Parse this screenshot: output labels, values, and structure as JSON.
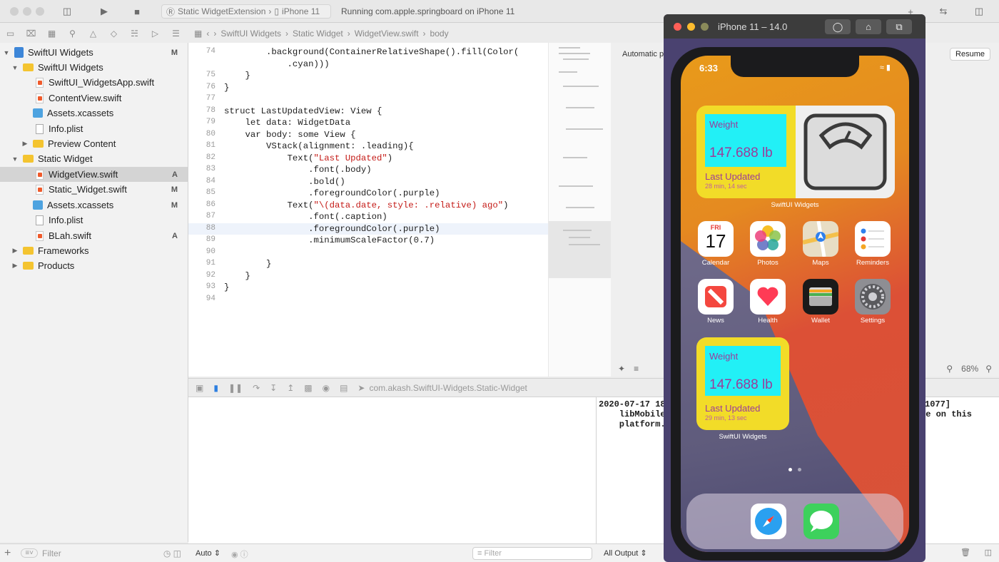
{
  "toolbar": {
    "scheme_target": "Static WidgetExtension",
    "scheme_device": "iPhone 11",
    "status_text": "Running com.apple.springboard on iPhone 11"
  },
  "navigator": {
    "items": [
      {
        "label": "SwiftUI Widgets",
        "badge": "M"
      },
      {
        "label": "SwiftUI Widgets",
        "badge": ""
      },
      {
        "label": "SwiftUI_WidgetsApp.swift",
        "badge": ""
      },
      {
        "label": "ContentView.swift",
        "badge": ""
      },
      {
        "label": "Assets.xcassets",
        "badge": ""
      },
      {
        "label": "Info.plist",
        "badge": ""
      },
      {
        "label": "Preview Content",
        "badge": ""
      },
      {
        "label": "Static Widget",
        "badge": ""
      },
      {
        "label": "WidgetView.swift",
        "badge": "A"
      },
      {
        "label": "Static_Widget.swift",
        "badge": "M"
      },
      {
        "label": "Assets.xcassets",
        "badge": "M"
      },
      {
        "label": "Info.plist",
        "badge": ""
      },
      {
        "label": "BLah.swift",
        "badge": "A"
      },
      {
        "label": "Frameworks",
        "badge": ""
      },
      {
        "label": "Products",
        "badge": ""
      }
    ],
    "filter_placeholder": "Filter"
  },
  "jumpbar": {
    "crumbs": [
      "SwiftUI Widgets",
      "Static Widget",
      "WidgetView.swift",
      "body"
    ]
  },
  "editor": {
    "lines": [
      {
        "n": "74",
        "code": "        .background(ContainerRelativeShape().fill(Color("
      },
      {
        "n": "",
        "code": "            .cyan)))"
      },
      {
        "n": "75",
        "code": "    }"
      },
      {
        "n": "76",
        "code": "}"
      },
      {
        "n": "77",
        "code": ""
      },
      {
        "n": "78",
        "code": "struct LastUpdatedView: View {"
      },
      {
        "n": "79",
        "code": "    let data: WidgetData"
      },
      {
        "n": "80",
        "code": "    var body: some View {"
      },
      {
        "n": "81",
        "code": "        VStack(alignment: .leading){"
      },
      {
        "n": "82",
        "code": "            Text(\"Last Updated\")"
      },
      {
        "n": "83",
        "code": "                .font(.body)"
      },
      {
        "n": "84",
        "code": "                .bold()"
      },
      {
        "n": "85",
        "code": "                .foregroundColor(.purple)"
      },
      {
        "n": "86",
        "code": "            Text(\"\\(data.date, style: .relative) ago\")"
      },
      {
        "n": "87",
        "code": "                .font(.caption)"
      },
      {
        "n": "88",
        "code": "                .foregroundColor(.purple)"
      },
      {
        "n": "89",
        "code": "                .minimumScaleFactor(0.7)"
      },
      {
        "n": "90",
        "code": ""
      },
      {
        "n": "91",
        "code": "        }"
      },
      {
        "n": "92",
        "code": "    }"
      },
      {
        "n": "93",
        "code": "}"
      },
      {
        "n": "94",
        "code": ""
      }
    ]
  },
  "canvas": {
    "label": "Automatic previ",
    "resume_label": "Resume",
    "zoom": "68%"
  },
  "debug": {
    "process": "com.akash.SwiftUI-Widgets.Static-Widget",
    "auto_label": "Auto",
    "filter_placeholder": "Filter",
    "output_label": "All Output",
    "console_lines": [
      "2020-07-17 18:",
      "    libMobileG",
      "    platform."
    ],
    "console_right": [
      "1077]",
      "he on this",
      ""
    ]
  },
  "simulator": {
    "title": "iPhone 11 – 14.0",
    "time": "6:33",
    "widget1": {
      "title": "Weight",
      "value": "147.688 lb",
      "last_updated": "Last Updated",
      "ago": "28 min, 14 sec",
      "label": "SwiftUI Widgets"
    },
    "widget2": {
      "title": "Weight",
      "value": "147.688 lb",
      "last_updated": "Last Updated",
      "ago": "29 min, 13 sec",
      "label": "SwiftUI Widgets"
    },
    "calendar": {
      "weekday": "FRI",
      "day": "17"
    },
    "apps": [
      {
        "label": "Calendar",
        "color": "#ffffff"
      },
      {
        "label": "Photos",
        "color": "#ffffff"
      },
      {
        "label": "Maps",
        "color": "#e8ddc4"
      },
      {
        "label": "Reminders",
        "color": "#ffffff"
      },
      {
        "label": "News",
        "color": "#ffffff"
      },
      {
        "label": "Health",
        "color": "#ffffff"
      },
      {
        "label": "Wallet",
        "color": "#1a1a1a"
      },
      {
        "label": "Settings",
        "color": "#8e8e93"
      }
    ],
    "dock": [
      {
        "icon": "safari-icon",
        "color": "#ffffff"
      },
      {
        "icon": "messages-icon",
        "color": "#3dd15c"
      }
    ]
  }
}
